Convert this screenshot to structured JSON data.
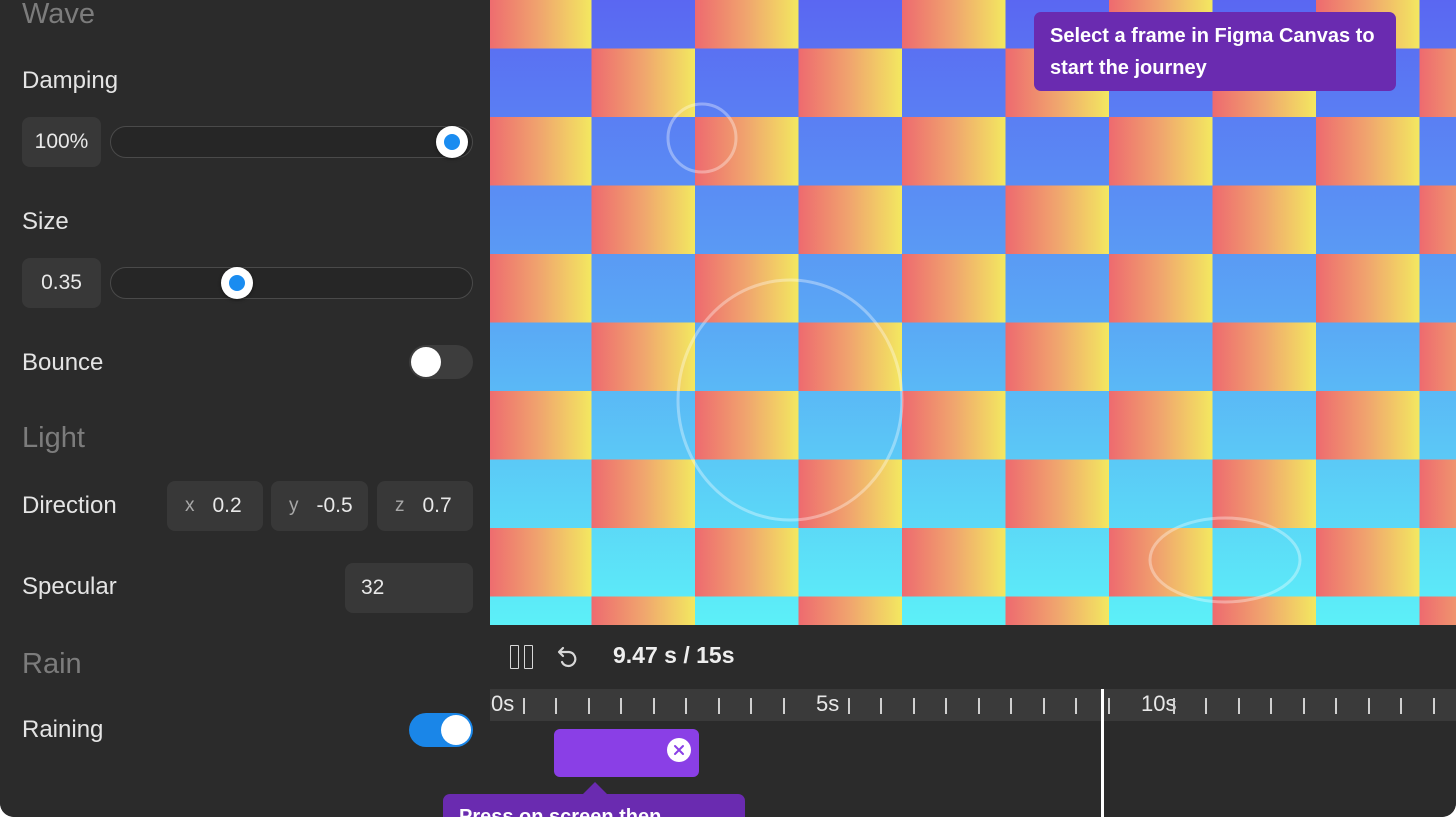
{
  "panel": {
    "wave": {
      "title": "Wave",
      "damping": {
        "label": "Damping",
        "value": "100%",
        "fraction": 1.0
      },
      "size": {
        "label": "Size",
        "value": "0.35",
        "fraction": 0.35
      },
      "bounce": {
        "label": "Bounce",
        "on": false
      }
    },
    "light": {
      "title": "Light",
      "direction": {
        "label": "Direction",
        "x_axis": "x",
        "x": "0.2",
        "y_axis": "y",
        "y": "-0.5",
        "z_axis": "z",
        "z": "0.7"
      },
      "specular": {
        "label": "Specular",
        "value": "32"
      }
    },
    "rain": {
      "title": "Rain",
      "raining": {
        "label": "Raining",
        "on": true
      }
    }
  },
  "canvas": {
    "tooltip": "Select a frame in Figma Canvas to start the journey"
  },
  "timeline": {
    "time_readout": "9.47 s / 15s",
    "ruler_labels": [
      "0s",
      "5s",
      "10s"
    ],
    "current_seconds": 9.47,
    "total_seconds": 15,
    "bottom_tooltip": "Press on screen then..."
  },
  "colors": {
    "accent_blue": "#1a8cf0",
    "tooltip_purple": "#6a2bb0",
    "clip_purple": "#8a3fe6",
    "panel_bg": "#2b2b2b"
  }
}
